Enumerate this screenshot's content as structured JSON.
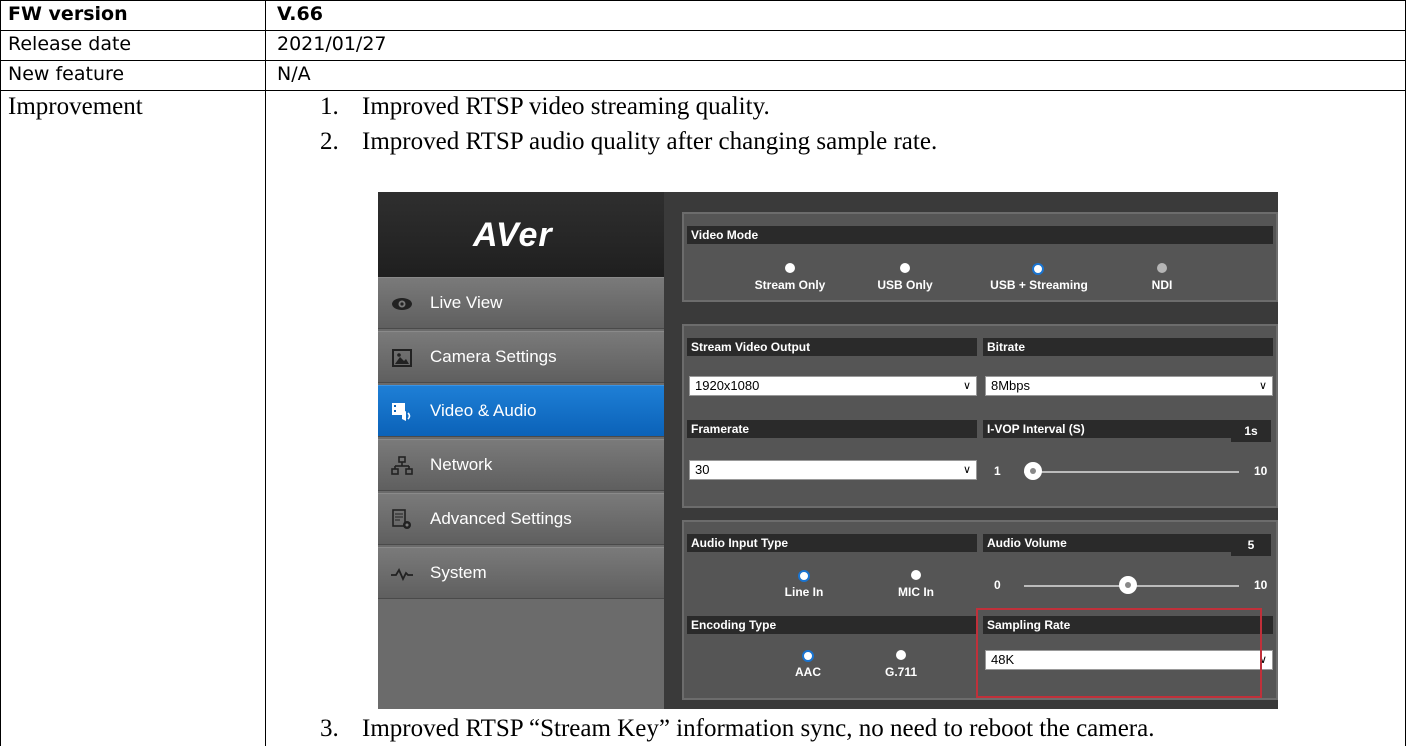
{
  "rows": {
    "fw_version_label": "FW version",
    "fw_version_value": "V.66",
    "release_date_label": "Release date",
    "release_date_value": "2021/01/27",
    "new_feature_label": "New feature",
    "new_feature_value": "N/A",
    "improvement_label": "Improvement"
  },
  "improvements": [
    {
      "num": "1.",
      "text": "Improved RTSP video streaming quality."
    },
    {
      "num": "2.",
      "text": "Improved RTSP audio quality after changing sample rate."
    },
    {
      "num": "3.",
      "text": "Improved RTSP “Stream Key” information sync, no need to reboot the camera."
    }
  ],
  "screenshot": {
    "logo": "AVer",
    "nav": [
      {
        "label": "Live View",
        "icon": "eye-icon"
      },
      {
        "label": "Camera Settings",
        "icon": "image-icon"
      },
      {
        "label": "Video & Audio",
        "icon": "video-audio-icon"
      },
      {
        "label": "Network",
        "icon": "network-icon"
      },
      {
        "label": "Advanced Settings",
        "icon": "advanced-settings-icon"
      },
      {
        "label": "System",
        "icon": "pulse-icon"
      }
    ],
    "video_mode": {
      "title": "Video Mode",
      "options": [
        "Stream Only",
        "USB Only",
        "USB + Streaming",
        "NDI"
      ],
      "selected": "USB + Streaming"
    },
    "stream_video_output": {
      "title": "Stream Video Output",
      "value": "1920x1080"
    },
    "bitrate": {
      "title": "Bitrate",
      "value": "8Mbps"
    },
    "framerate": {
      "title": "Framerate",
      "value": "30"
    },
    "ivop": {
      "title": "I-VOP Interval (S)",
      "value": "1s",
      "min": "1",
      "max": "10",
      "level": 1
    },
    "audio_input_type": {
      "title": "Audio Input Type",
      "options": [
        "Line In",
        "MIC In"
      ],
      "selected": "Line In"
    },
    "audio_volume": {
      "title": "Audio Volume",
      "value": "5",
      "min": "0",
      "max": "10",
      "level": 5
    },
    "encoding_type": {
      "title": "Encoding Type",
      "options": [
        "AAC",
        "G.711"
      ],
      "selected": "AAC"
    },
    "sampling_rate": {
      "title": "Sampling Rate",
      "value": "48K"
    },
    "colors": {
      "active_nav": "#0b62b8",
      "highlight": "#c0303a",
      "radio_selected": "#1a74d0"
    }
  }
}
